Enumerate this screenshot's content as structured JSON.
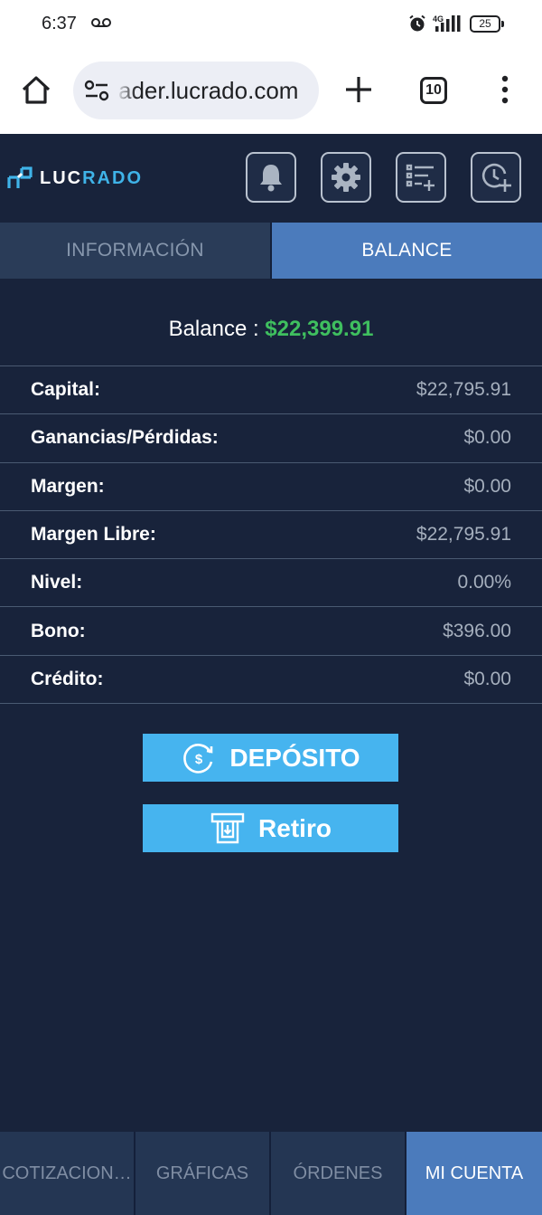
{
  "status_bar": {
    "time": "6:37",
    "battery": "25",
    "network": "4G"
  },
  "browser": {
    "url": "ader.lucrado.com",
    "tab_count": "10"
  },
  "app": {
    "logo_part1": "LUC",
    "logo_part2": "RADO"
  },
  "tabs": {
    "info": "INFORMACIÓN",
    "balance": "BALANCE"
  },
  "balance": {
    "label": "Balance : ",
    "amount": "$22,399.91"
  },
  "rows": [
    {
      "label": "Capital:",
      "value": "$22,795.91"
    },
    {
      "label": "Ganancias/Pérdidas:",
      "value": "$0.00"
    },
    {
      "label": "Margen:",
      "value": "$0.00"
    },
    {
      "label": "Margen Libre:",
      "value": "$22,795.91"
    },
    {
      "label": "Nivel:",
      "value": "0.00%"
    },
    {
      "label": "Bono:",
      "value": "$396.00"
    },
    {
      "label": "Crédito:",
      "value": "$0.00"
    }
  ],
  "actions": {
    "deposit": "DEPÓSITO",
    "withdraw": "Retiro"
  },
  "bottom_nav": [
    {
      "label": "COTIZACION…"
    },
    {
      "label": "GRÁFICAS"
    },
    {
      "label": "ÓRDENES"
    },
    {
      "label": "MI CUENTA"
    }
  ],
  "colors": {
    "background": "#18233b",
    "accent": "#46b4ef",
    "active_tab": "#4b7bbc",
    "balance_green": "#3fbf5f"
  }
}
